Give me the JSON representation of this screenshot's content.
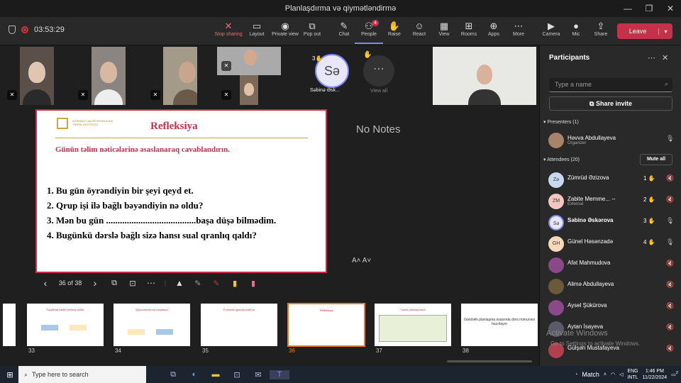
{
  "window": {
    "title": "Planlaşdırma və qiymətləndirmə",
    "minimize": "—",
    "maximize": "❐",
    "close": "✕"
  },
  "toolbar": {
    "timer": "03:53:29",
    "buttons": [
      {
        "label": "Stop sharing",
        "icon": "✕"
      },
      {
        "label": "Layout",
        "icon": "▭"
      },
      {
        "label": "Private view",
        "icon": "◉"
      },
      {
        "label": "Pop out",
        "icon": "⧉"
      },
      {
        "label": "Chat",
        "icon": "✎"
      },
      {
        "label": "People",
        "icon": "⚇",
        "badge": "4"
      },
      {
        "label": "Raise",
        "icon": "✋"
      },
      {
        "label": "React",
        "icon": "☺"
      },
      {
        "label": "View",
        "icon": "▦"
      },
      {
        "label": "Rooms",
        "icon": "⊞"
      },
      {
        "label": "Apps",
        "icon": "⊕"
      },
      {
        "label": "More",
        "icon": "⋯"
      },
      {
        "label": "Camera",
        "icon": "▶"
      },
      {
        "label": "Mic",
        "icon": "●"
      },
      {
        "label": "Share",
        "icon": "⇪"
      }
    ],
    "leave": "Leave"
  },
  "stage": {
    "speaker_badge": "3",
    "speaker_initials": "Sə",
    "speaker_name": "Səbinə Əsk...",
    "more_label": "View all",
    "more_icon": "⋯",
    "no_notes": "No Notes",
    "font_ctrls": "A˄  A˅"
  },
  "slide": {
    "title": "Refleksiya",
    "org": "AZƏRBAYCAN RESPUBLİKASI TƏHSİL İNSTİTUTU",
    "subtitle": "Günün təlim nəticələrinə əsaslanaraq cavablandırın.",
    "items": [
      "1.  Bu gün öyrəndiyin bir şeyi qeyd et.",
      "2.  Qrup işi ilə bağlı bəyəndiyin nə oldu?",
      "3.  Mən bu gün .......................................başa düşə bilmədim.",
      "4.  Bugünkü dərslə bağlı sizə hansı sual qranlıq qaldı?"
    ]
  },
  "slide_nav": {
    "prev": "‹",
    "counter": "36 of 38",
    "next": "›"
  },
  "thumbnails": [
    {
      "num": "33",
      "title": "Təqdimat təklifi verilmiş dəftər"
    },
    {
      "num": "34",
      "title": "Qiymətləndirmə meyarları"
    },
    {
      "num": "35",
      "title": "Formativ qiymətləndirmə"
    },
    {
      "num": "36",
      "title": "Refleksiya"
    },
    {
      "num": "37",
      "title": "Tədris planlaşdırma"
    },
    {
      "num": "38",
      "title": "Gündəlik planlaşma əsasında dərs nümunəsi hazırlayın"
    }
  ],
  "panel": {
    "title": "Participants",
    "more": "⋯",
    "close": "✕",
    "search_placeholder": "Type a name",
    "invite": "Share invite",
    "presenters_label": "Presenters (1)",
    "attendees_label": "Attendees (20)",
    "mute_all": "Mute all",
    "presenter": {
      "name": "Həvva Abdullayeva",
      "sub": "Organizer"
    },
    "attendees": [
      {
        "initials": "Zə",
        "name": "Zümrüd Əzizova",
        "hand": "1",
        "color": "#c8d8ee"
      },
      {
        "initials": "ZM",
        "name": "Zabite Memme... --",
        "sub": "External",
        "hand": "2",
        "color": "#f2c6c1"
      },
      {
        "initials": "Sə",
        "name": "Səbinə Əskərova",
        "hand": "3",
        "color": "#e7e7f9",
        "bold": true
      },
      {
        "initials": "GH",
        "name": "Günel Həsənzadə",
        "hand": "4",
        "color": "#f6d9b8"
      },
      {
        "initials": "",
        "name": "Afət Mahmudova",
        "color": "#8a4a8a"
      },
      {
        "initials": "",
        "name": "Alimə Abdullayeva",
        "color": "#6a5a3a"
      },
      {
        "initials": "",
        "name": "Aysel Şükürova",
        "color": "#8a4a8a"
      },
      {
        "initials": "",
        "name": "Aytan İsayeva",
        "color": "#5a5a6a"
      },
      {
        "initials": "",
        "name": "Gülşən Mustafayeva",
        "color": "#b04050"
      }
    ]
  },
  "watermark": {
    "line1": "Activate Windows",
    "line2": "Go to Settings to activate Windows."
  },
  "taskbar": {
    "search_placeholder": "Type here to search",
    "match": "Match",
    "lang1": "ENG",
    "lang2": "INTL",
    "time": "1:46 PM",
    "date": "11/22/2024",
    "notif": "2"
  }
}
